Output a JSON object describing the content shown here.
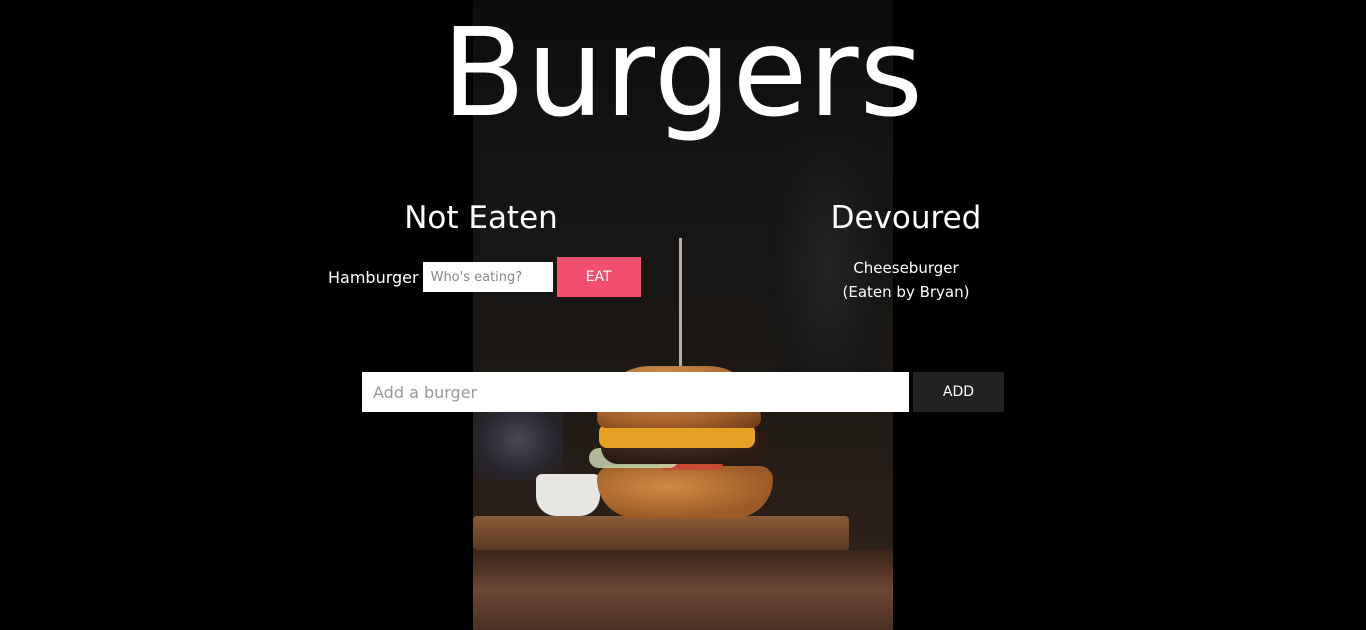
{
  "header": {
    "title": "Burgers"
  },
  "not_eaten": {
    "heading": "Not Eaten",
    "items": [
      {
        "name": "Hamburger",
        "eater_placeholder": "Who's eating?",
        "eat_label": "EAT"
      }
    ]
  },
  "devoured": {
    "heading": "Devoured",
    "items": [
      {
        "name": "Cheeseburger",
        "eaten_by": "(Eaten by Bryan)"
      }
    ]
  },
  "add_form": {
    "placeholder": "Add a burger",
    "button_label": "ADD"
  },
  "colors": {
    "background": "#000000",
    "eat_button": "#f0506e",
    "add_button": "#222222"
  }
}
